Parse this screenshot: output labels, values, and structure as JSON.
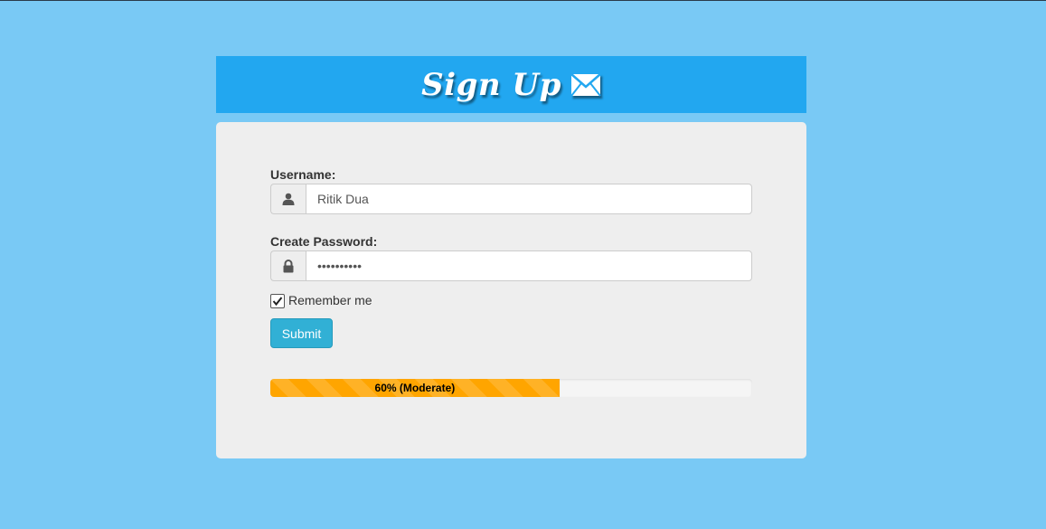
{
  "header": {
    "title": "Sign Up",
    "icon": "envelope-icon"
  },
  "form": {
    "username_label": "Username:",
    "username_value": "Ritik Dua",
    "username_icon": "user-icon",
    "password_label": "Create Password:",
    "password_value": "••••••••••",
    "password_icon": "lock-icon",
    "remember_label": "Remember me",
    "remember_checked": true,
    "submit_label": "Submit"
  },
  "strength": {
    "percent": 60,
    "label": "60% (Moderate)"
  },
  "colors": {
    "background": "#79c9f5",
    "header": "#22a7f0",
    "panel": "#eeeeee",
    "button": "#31b0d5",
    "strength_bar": "#ffa500"
  }
}
